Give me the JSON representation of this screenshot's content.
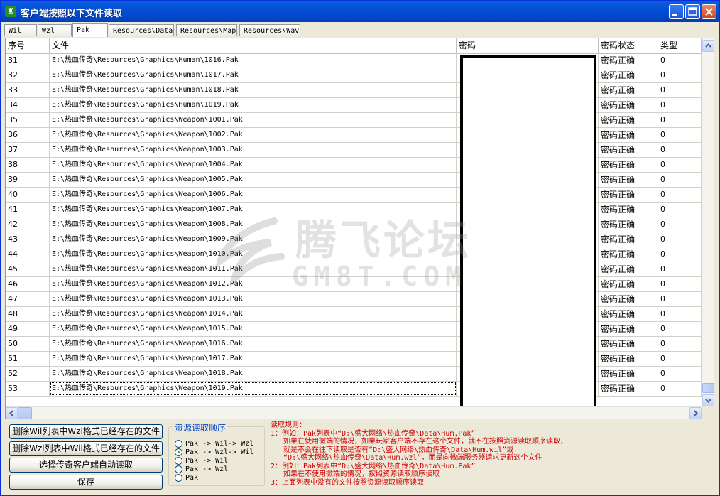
{
  "window": {
    "title": "客户端按照以下文件读取"
  },
  "tabs": [
    "Wil",
    "Wzl",
    "Pak",
    "Resources\\Data",
    "Resources\\Map",
    "Resources\\Wav"
  ],
  "active_tab": "Pak",
  "table": {
    "columns": [
      "序号",
      "文件",
      "密码",
      "密码状态",
      "类型"
    ],
    "rows": [
      {
        "idx": "31",
        "file": "E:\\热血传奇\\Resources\\Graphics\\Human\\1016.Pak",
        "status": "密码正确",
        "type": "0"
      },
      {
        "idx": "32",
        "file": "E:\\热血传奇\\Resources\\Graphics\\Human\\1017.Pak",
        "status": "密码正确",
        "type": "0"
      },
      {
        "idx": "33",
        "file": "E:\\热血传奇\\Resources\\Graphics\\Human\\1018.Pak",
        "status": "密码正确",
        "type": "0"
      },
      {
        "idx": "34",
        "file": "E:\\热血传奇\\Resources\\Graphics\\Human\\1019.Pak",
        "status": "密码正确",
        "type": "0"
      },
      {
        "idx": "35",
        "file": "E:\\热血传奇\\Resources\\Graphics\\Weapon\\1001.Pak",
        "status": "密码正确",
        "type": "0"
      },
      {
        "idx": "36",
        "file": "E:\\热血传奇\\Resources\\Graphics\\Weapon\\1002.Pak",
        "status": "密码正确",
        "type": "0"
      },
      {
        "idx": "37",
        "file": "E:\\热血传奇\\Resources\\Graphics\\Weapon\\1003.Pak",
        "status": "密码正确",
        "type": "0"
      },
      {
        "idx": "38",
        "file": "E:\\热血传奇\\Resources\\Graphics\\Weapon\\1004.Pak",
        "status": "密码正确",
        "type": "0"
      },
      {
        "idx": "39",
        "file": "E:\\热血传奇\\Resources\\Graphics\\Weapon\\1005.Pak",
        "status": "密码正确",
        "type": "0"
      },
      {
        "idx": "40",
        "file": "E:\\热血传奇\\Resources\\Graphics\\Weapon\\1006.Pak",
        "status": "密码正确",
        "type": "0"
      },
      {
        "idx": "41",
        "file": "E:\\热血传奇\\Resources\\Graphics\\Weapon\\1007.Pak",
        "status": "密码正确",
        "type": "0"
      },
      {
        "idx": "42",
        "file": "E:\\热血传奇\\Resources\\Graphics\\Weapon\\1008.Pak",
        "status": "密码正确",
        "type": "0"
      },
      {
        "idx": "43",
        "file": "E:\\热血传奇\\Resources\\Graphics\\Weapon\\1009.Pak",
        "status": "密码正确",
        "type": "0"
      },
      {
        "idx": "44",
        "file": "E:\\热血传奇\\Resources\\Graphics\\Weapon\\1010.Pak",
        "status": "密码正确",
        "type": "0"
      },
      {
        "idx": "45",
        "file": "E:\\热血传奇\\Resources\\Graphics\\Weapon\\1011.Pak",
        "status": "密码正确",
        "type": "0"
      },
      {
        "idx": "46",
        "file": "E:\\热血传奇\\Resources\\Graphics\\Weapon\\1012.Pak",
        "status": "密码正确",
        "type": "0"
      },
      {
        "idx": "47",
        "file": "E:\\热血传奇\\Resources\\Graphics\\Weapon\\1013.Pak",
        "status": "密码正确",
        "type": "0"
      },
      {
        "idx": "48",
        "file": "E:\\热血传奇\\Resources\\Graphics\\Weapon\\1014.Pak",
        "status": "密码正确",
        "type": "0"
      },
      {
        "idx": "49",
        "file": "E:\\热血传奇\\Resources\\Graphics\\Weapon\\1015.Pak",
        "status": "密码正确",
        "type": "0"
      },
      {
        "idx": "50",
        "file": "E:\\热血传奇\\Resources\\Graphics\\Weapon\\1016.Pak",
        "status": "密码正确",
        "type": "0"
      },
      {
        "idx": "51",
        "file": "E:\\热血传奇\\Resources\\Graphics\\Weapon\\1017.Pak",
        "status": "密码正确",
        "type": "0"
      },
      {
        "idx": "52",
        "file": "E:\\热血传奇\\Resources\\Graphics\\Weapon\\1018.Pak",
        "status": "密码正确",
        "type": "0"
      },
      {
        "idx": "53",
        "file": "E:\\热血传奇\\Resources\\Graphics\\Weapon\\1019.Pak",
        "status": "密码正确",
        "type": "0"
      }
    ],
    "selected_row": "53"
  },
  "watermark": {
    "main": "腾飞论坛",
    "sub": "GM8T.COM"
  },
  "buttons": {
    "delete_wil_in_wzl": "删除Wil列表中Wzl格式已经存在的文件",
    "delete_wzl_in_wil": "删除Wzl列表中Wil格式已经存在的文件",
    "auto_read": "选择传奇客户端自动读取",
    "save": "保存"
  },
  "read_order": {
    "title": "资源读取顺序",
    "options": [
      "Pak -> Wil-> Wzl",
      "Pak -> Wzl-> Wil",
      "Pak -> Wil",
      "Pak -> Wzl",
      "Pak"
    ],
    "selected": "Pak -> Wzl-> Wil"
  },
  "rules": {
    "lines": [
      "读取规则：",
      "1：例如：Pak列表中“D:\\盛大网络\\热血传奇\\Data\\Hum.Pak”",
      "   如果在使用微端的情况，如果玩家客户端不存在这个文件，就不在按照资源读取顺序读取，",
      "   就是不会在往下读取是否有“D:\\盛大网络\\热血传奇\\Data\\Hum.wil”或",
      "   “D:\\盛大网络\\热血传奇\\Data\\Hum.wzl”，而是向微端服务器请求更新这个文件",
      "2：例如：Pak列表中“D:\\盛大网络\\热血传奇\\Data\\Hum.Pak”",
      "   如果在不使用微端的情况，按照资源读取顺序读取",
      "3：上面列表中没有的文件按照资源读取顺序读取"
    ]
  },
  "colors": {
    "titlebar": "#0450D6",
    "rules_text": "#D00000",
    "group_title": "#0046D5"
  }
}
